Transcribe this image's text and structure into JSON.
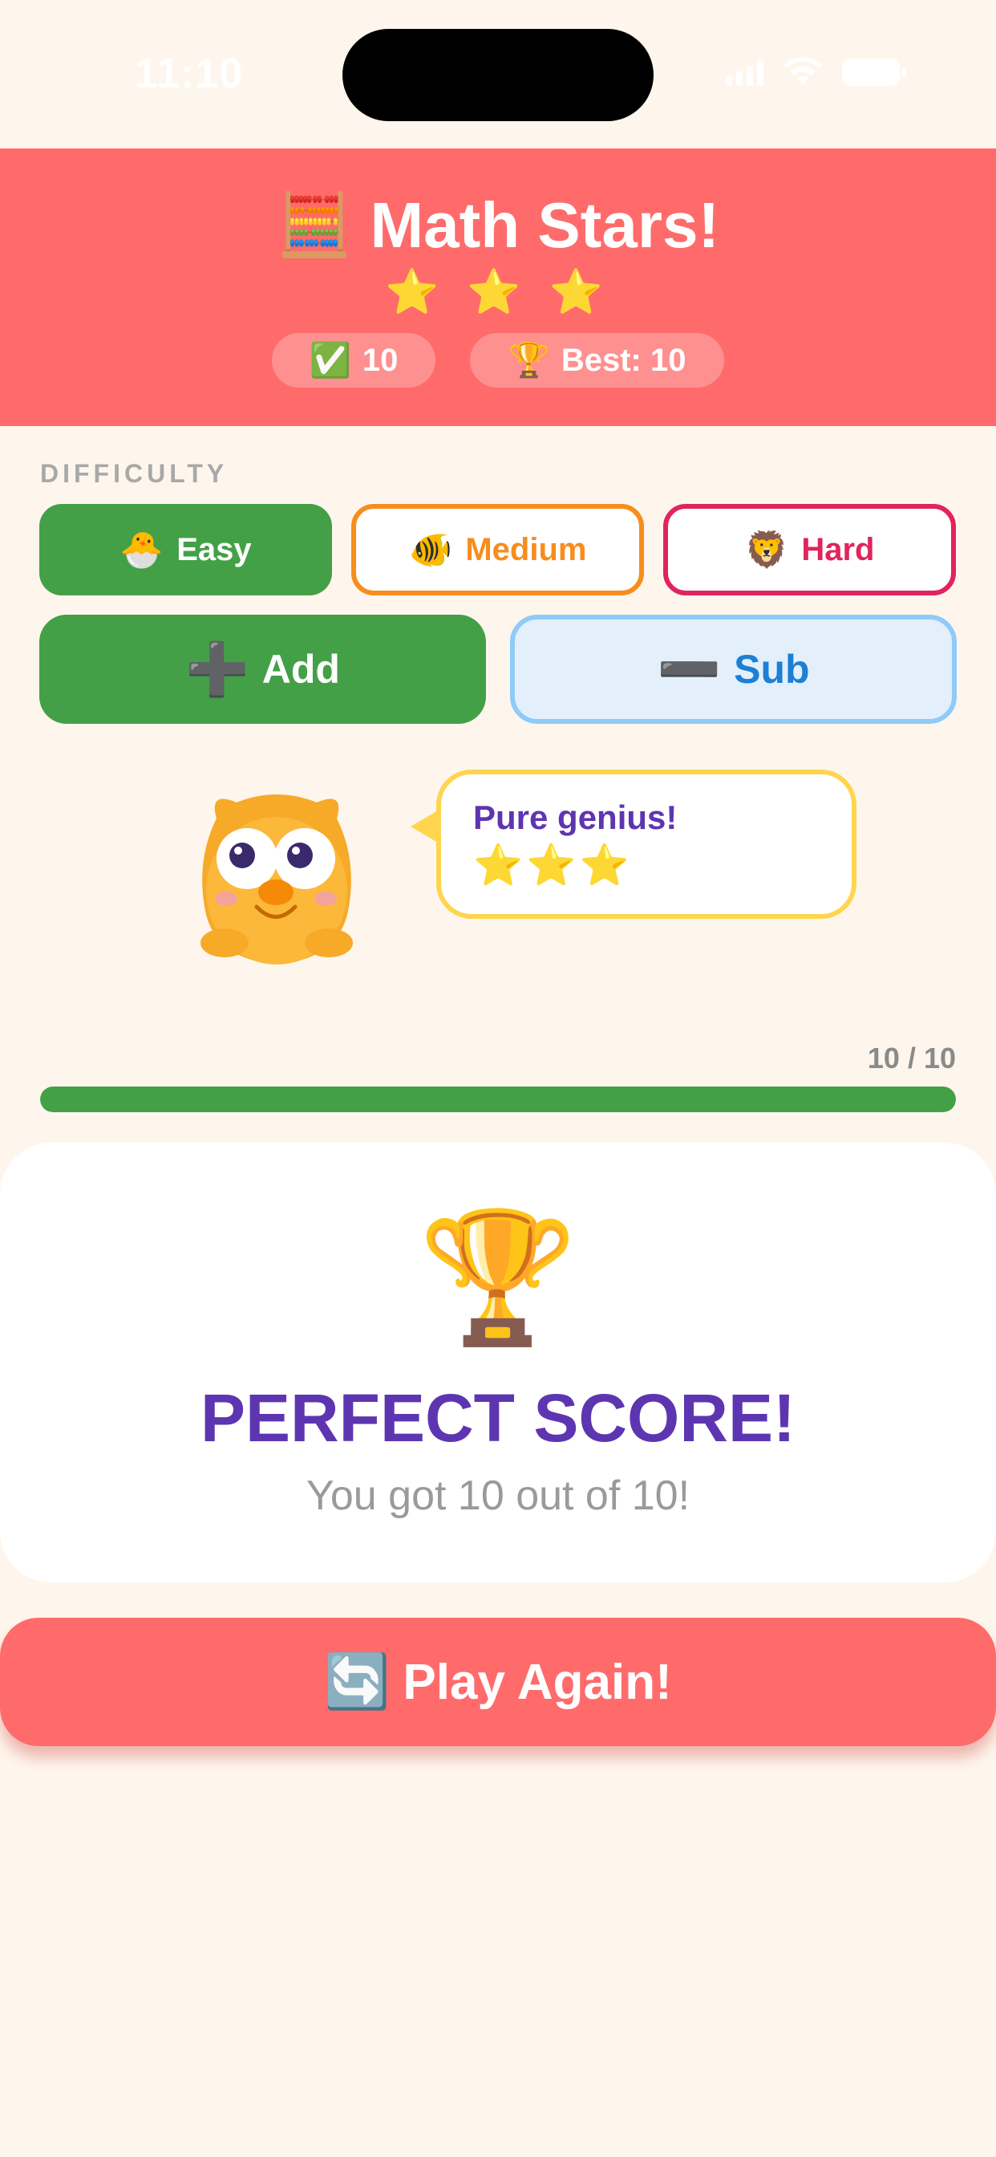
{
  "status_bar": {
    "time": "11:10",
    "icons": [
      "signal-icon",
      "wifi-icon",
      "battery-icon"
    ]
  },
  "header": {
    "icon": "🧮",
    "title": "Math Stars!",
    "stars": "⭐ ⭐ ⭐",
    "correct_icon": "✅",
    "correct_count": "10",
    "best_icon": "🏆",
    "best_label": "Best: 10",
    "background_color": "#FF6B6B"
  },
  "difficulty": {
    "label": "DIFFICULTY",
    "options": [
      {
        "emoji": "🐣",
        "label": "Easy",
        "selected": true,
        "color": "#43A047"
      },
      {
        "emoji": "🐠",
        "label": "Medium",
        "selected": false,
        "color": "#F78D1E"
      },
      {
        "emoji": "🦁",
        "label": "Hard",
        "selected": false,
        "color": "#E0245E"
      }
    ]
  },
  "operations": [
    {
      "glyph": "➕",
      "label": "Add",
      "selected": true,
      "color": "#43A047"
    },
    {
      "glyph": "➖",
      "label": "Sub",
      "selected": false,
      "color": "#1E7FD6"
    }
  ],
  "mascot": {
    "icon": "owl-mascot-icon",
    "speech": "Pure genius!",
    "speech_stars": "⭐⭐⭐"
  },
  "progress": {
    "label": "10 / 10",
    "fraction": 1.0
  },
  "result": {
    "icon": "🏆",
    "title": "PERFECT SCORE!",
    "subtitle": "You got 10 out of 10!"
  },
  "play_again": {
    "emoji": "🔄",
    "label": "Play Again!"
  }
}
